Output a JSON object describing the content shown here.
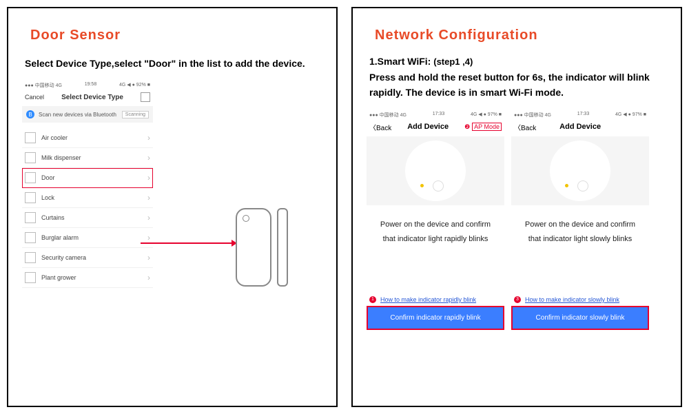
{
  "left": {
    "title": "Door Sensor",
    "instruction": "Select Device Type,select \"Door\" in the list to add the device.",
    "phone": {
      "status_left": "●●● 中国移动 4G",
      "status_time": "19:58",
      "status_right": "4G ◀ ● 92% ■",
      "nav_left": "Cancel",
      "nav_title": "Select Device Type",
      "bt_text": "Scan new devices via Bluetooth",
      "bt_button": "Scanning",
      "items": [
        "Air cooler",
        "Milk dispenser",
        "Door",
        "Lock",
        "Curtains",
        "Burglar alarm",
        "Security camera",
        "Plant grower"
      ],
      "highlight_index": 2
    }
  },
  "right": {
    "title": "Network Configuration",
    "step_bold": "1.Smart WiFi:",
    "step_sub": "(step1 ,4)",
    "paragraph": "Press and hold the reset button for 6s, the indicator will blink rapidly. The device is in smart Wi-Fi mode.",
    "phoneA": {
      "status_left": "●●● 中国移动 4G",
      "status_time": "17:33",
      "status_right": "4G ◀ ● 97% ■",
      "back": "〈Back",
      "nav_title": "Add Device",
      "mode_num": "❷",
      "mode_label": "AP Mode",
      "confirm_line1": "Power on the device and confirm",
      "confirm_line2": "that indicator light rapidly blinks",
      "help_num": "1",
      "help_link": "How to make indicator rapidly blink",
      "button": "Confirm indicator rapidly blink"
    },
    "phoneB": {
      "status_left": "●●● 中国移动 4G",
      "status_time": "17:33",
      "status_right": "4G ◀ ● 97% ■",
      "back": "〈Back",
      "nav_title": "Add Device",
      "confirm_line1": "Power on the device and confirm",
      "confirm_line2": "that indicator light slowly blinks",
      "help_num": "3",
      "help_link": "How to make indicator slowly blink",
      "button": "Confirm indicator slowly blink"
    }
  }
}
